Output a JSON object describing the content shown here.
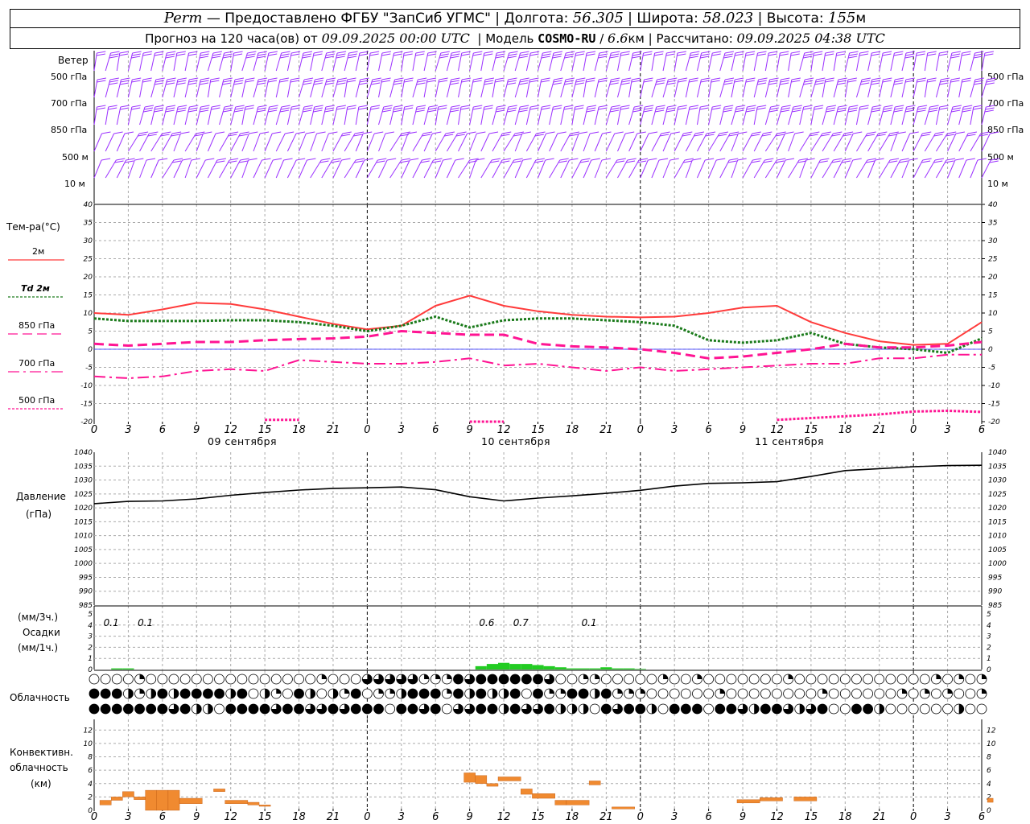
{
  "header": {
    "station": "Perm",
    "provider": "— Предоставлено ФГБУ \"ЗапСиб УГМС\"",
    "lon_label": "Долгота:",
    "lon": "56.305",
    "lat_label": "Широта:",
    "lat": "58.023",
    "alt_label": "Высота:",
    "alt": "155",
    "alt_unit": "м",
    "forecast_label": "Прогноз на 120 часа(ов) от",
    "forecast_start": "09.09.2025 00:00 UTC",
    "model_label": "Модель",
    "model": "COSMO-RU",
    "model_res": "6.6",
    "model_res_unit": "км",
    "computed_label": "Рассчитано:",
    "computed": "09.09.2025 04:38 UTC"
  },
  "wind_panel": {
    "title": "Ветер",
    "levels": [
      "500 гПа",
      "700 гПа",
      "850 гПа",
      "500 м",
      "10 м"
    ],
    "color": "#9b30ff"
  },
  "temp_panel": {
    "title": "Тем-ра(°С)",
    "legend": [
      {
        "label": "2м",
        "color": "#ff3b3b",
        "style": "solid"
      },
      {
        "label": "Td 2м",
        "color": "#1a7a1a",
        "style": "dotted"
      },
      {
        "label": "850 гПа",
        "color": "#ff1493",
        "style": "dashed"
      },
      {
        "label": "700 гПа",
        "color": "#ff1493",
        "style": "dashdot"
      },
      {
        "label": "500 гПа",
        "color": "#ff1493",
        "style": "dotted"
      }
    ],
    "y_ticks": [
      "40",
      "35",
      "30",
      "25",
      "20",
      "15",
      "10",
      "5",
      "0",
      "-5",
      "-10",
      "-15",
      "-20"
    ]
  },
  "x_axis": {
    "ticks": [
      "0",
      "3",
      "6",
      "9",
      "12",
      "15",
      "18",
      "21",
      "0",
      "3",
      "6",
      "9",
      "12",
      "15",
      "18",
      "21",
      "0",
      "3",
      "6",
      "9",
      "12",
      "15",
      "18",
      "21",
      "0",
      "3",
      "6"
    ],
    "dates": [
      "09 сентября",
      "10 сентября",
      "11 сентября"
    ]
  },
  "pressure_panel": {
    "title": "Давление",
    "unit": "(гПа)",
    "y_ticks": [
      "1040",
      "1035",
      "1030",
      "1025",
      "1020",
      "1015",
      "1010",
      "1005",
      "1000",
      "995",
      "990",
      "985"
    ]
  },
  "precip_panel": {
    "unit3": "(мм/3ч.)",
    "title": "Осадки",
    "unit1": "(мм/1ч.)",
    "y_ticks": [
      "5",
      "4",
      "3",
      "2",
      "1",
      "0"
    ],
    "labels": [
      "0.1",
      "0.1",
      "0.6",
      "0.7",
      "0.1"
    ],
    "color": "#22cc22"
  },
  "cloud_panel": {
    "title": "Облачность"
  },
  "conv_panel": {
    "title_1": "Конвективн.",
    "title_2": "облачность",
    "unit": "(км)",
    "y_ticks": [
      "12",
      "10",
      "8",
      "6",
      "4",
      "2",
      "0"
    ],
    "color": "#f08a30"
  },
  "chart_data": [
    {
      "type": "line",
      "title": "Тем-ра(°С)",
      "x_hours": [
        0,
        3,
        6,
        9,
        12,
        15,
        18,
        21,
        24,
        27,
        30,
        33,
        36,
        39,
        42,
        45,
        48,
        51,
        54,
        57,
        60,
        63,
        66,
        69,
        72,
        75,
        78
      ],
      "ylim": [
        -20,
        40
      ],
      "series": [
        {
          "name": "2м",
          "values": [
            10,
            9.5,
            11,
            12.8,
            12.5,
            11,
            9,
            7,
            5.5,
            6.5,
            12,
            14.8,
            12,
            10.5,
            9.5,
            9,
            8.8,
            9,
            10,
            11.5,
            12,
            7.5,
            4.5,
            2.2,
            1.2,
            1.5,
            7.5
          ]
        },
        {
          "name": "Td 2м",
          "values": [
            8.5,
            7.8,
            7.8,
            7.8,
            8,
            8,
            7.5,
            6.5,
            5,
            6.5,
            9,
            6,
            8,
            8.5,
            8.5,
            8,
            7.5,
            6.5,
            2.5,
            1.8,
            2.5,
            4.5,
            1.5,
            0.5,
            0,
            -1,
            3
          ]
        },
        {
          "name": "850 гПа",
          "values": [
            1.5,
            1,
            1.5,
            2,
            2,
            2.5,
            2.8,
            3,
            3.5,
            5,
            4.5,
            4,
            4,
            1.5,
            0.8,
            0.5,
            0,
            -1,
            -2.5,
            -2,
            -1,
            0,
            1.5,
            0.5,
            0.5,
            1,
            2
          ]
        },
        {
          "name": "700 гПа",
          "values": [
            -7.5,
            -8,
            -7.5,
            -6,
            -5.5,
            -6,
            -3,
            -3.5,
            -4,
            -4,
            -3.5,
            -2.5,
            -4.5,
            -4,
            -5,
            -6,
            -5,
            -6,
            -5.5,
            -5,
            -4.5,
            -4,
            -4,
            -2.5,
            -2.5,
            -1.5,
            -1.5
          ]
        },
        {
          "name": "500 гПа",
          "values": [
            null,
            null,
            null,
            null,
            null,
            -19.5,
            -19.5,
            null,
            null,
            null,
            null,
            -20,
            -20,
            null,
            null,
            null,
            null,
            null,
            null,
            null,
            -19.5,
            -19,
            -18.5,
            -18,
            -17.2,
            -17,
            -17.3
          ]
        }
      ]
    },
    {
      "type": "line",
      "title": "Давление",
      "x_hours": [
        0,
        3,
        6,
        9,
        12,
        15,
        18,
        21,
        24,
        27,
        30,
        33,
        36,
        39,
        42,
        45,
        48,
        51,
        54,
        57,
        60,
        63,
        66,
        69,
        72,
        75,
        78
      ],
      "ylim": [
        985,
        1040
      ],
      "series": [
        {
          "name": "Давление",
          "values": [
            1021.5,
            1022.3,
            1022.5,
            1023.2,
            1024.5,
            1025.5,
            1026.4,
            1027,
            1027.2,
            1027.5,
            1026.5,
            1024,
            1022.5,
            1023.5,
            1024.3,
            1025.2,
            1026.3,
            1027.8,
            1028.8,
            1029,
            1029.4,
            1031.3,
            1033.4,
            1034.1,
            1034.8,
            1035.2,
            1035.3
          ]
        }
      ]
    },
    {
      "type": "bar",
      "title": "Осадки",
      "x_hours": [
        2,
        3,
        34,
        35,
        36,
        37,
        38,
        39,
        40,
        41,
        42,
        43,
        44,
        45,
        46,
        47,
        48
      ],
      "ylim": [
        0,
        5
      ],
      "values": [
        0.1,
        0.1,
        0.3,
        0.5,
        0.6,
        0.5,
        0.5,
        0.4,
        0.3,
        0.2,
        0.1,
        0.1,
        0.1,
        0.2,
        0.1,
        0.1,
        0.05
      ]
    },
    {
      "type": "bar",
      "title": "Конвективн. облачность (км)",
      "ylim": [
        0,
        13
      ],
      "segments": [
        [
          0.5,
          1.5,
          0.8,
          1.5
        ],
        [
          1.5,
          2.5,
          1.5,
          2
        ],
        [
          2.5,
          3.5,
          2,
          2.8
        ],
        [
          3.5,
          4.5,
          1.6,
          2
        ],
        [
          4.5,
          5.5,
          0,
          3
        ],
        [
          5.5,
          6.5,
          0,
          3
        ],
        [
          6.5,
          7.5,
          0,
          3
        ],
        [
          7.5,
          9.5,
          1,
          1.8
        ],
        [
          10.5,
          11.5,
          2.8,
          3.2
        ],
        [
          11.5,
          13.5,
          1,
          1.5
        ],
        [
          13.5,
          14.5,
          0.8,
          1.2
        ],
        [
          14.5,
          15.5,
          0.6,
          0.8
        ],
        [
          32.5,
          33.5,
          4.2,
          5.6
        ],
        [
          33.5,
          34.5,
          4,
          5.2
        ],
        [
          34.5,
          35.5,
          3.6,
          4
        ],
        [
          35.5,
          37.5,
          4.4,
          5
        ],
        [
          37.5,
          38.5,
          2.4,
          3.2
        ],
        [
          38.5,
          40.5,
          1.8,
          2.5
        ],
        [
          40.5,
          41.5,
          0.8,
          1.5
        ],
        [
          41.5,
          43.5,
          0.8,
          1.5
        ],
        [
          43.5,
          44.5,
          3.8,
          4.4
        ],
        [
          45.5,
          47.5,
          0.2,
          0.5
        ],
        [
          56.5,
          58.5,
          1.1,
          1.6
        ],
        [
          58.5,
          60.5,
          1.4,
          1.9
        ],
        [
          61.5,
          63.5,
          1.4,
          2
        ],
        [
          78.5,
          79,
          1.2,
          1.8
        ]
      ]
    }
  ]
}
